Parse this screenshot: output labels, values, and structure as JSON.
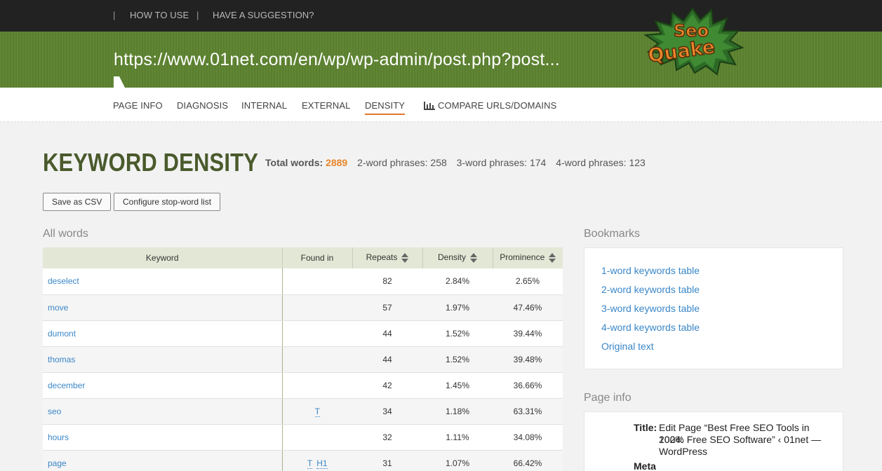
{
  "topbar": {
    "separators": [
      "|",
      "|"
    ],
    "links": [
      "HOW TO USE",
      "HAVE A SUGGESTION?"
    ]
  },
  "url": "https://www.01net.com/en/wp/wp-admin/post.php?post...",
  "logo": {
    "line1": "Seo",
    "line2": "Quake"
  },
  "nav": {
    "tabs": [
      "PAGE INFO",
      "DIAGNOSIS",
      "INTERNAL",
      "EXTERNAL",
      "DENSITY",
      "COMPARE URLS/DOMAINS"
    ],
    "active": "DENSITY",
    "compare_icon": "bar-chart-icon"
  },
  "heading": "KEYWORD DENSITY",
  "stats": {
    "total_label": "Total words:",
    "total_value": "2889",
    "two_label": "2-word phrases:",
    "two_value": "258",
    "three_label": "3-word phrases:",
    "three_value": "174",
    "four_label": "4-word phrases:",
    "four_value": "123"
  },
  "buttons": {
    "save_csv": "Save as CSV",
    "configure": "Configure stop-word list"
  },
  "all_words": {
    "title": "All words",
    "columns": [
      "Keyword",
      "Found in",
      "Repeats",
      "Density",
      "Prominence"
    ],
    "rows": [
      {
        "keyword": "deselect",
        "found_in": [],
        "repeats": "82",
        "density": "2.84%",
        "prominence": "2.65%"
      },
      {
        "keyword": "move",
        "found_in": [],
        "repeats": "57",
        "density": "1.97%",
        "prominence": "47.46%"
      },
      {
        "keyword": "dumont",
        "found_in": [],
        "repeats": "44",
        "density": "1.52%",
        "prominence": "39.44%"
      },
      {
        "keyword": "thomas",
        "found_in": [],
        "repeats": "44",
        "density": "1.52%",
        "prominence": "39.48%"
      },
      {
        "keyword": "december",
        "found_in": [],
        "repeats": "42",
        "density": "1.45%",
        "prominence": "36.66%"
      },
      {
        "keyword": "seo",
        "found_in": [
          "T"
        ],
        "repeats": "34",
        "density": "1.18%",
        "prominence": "63.31%"
      },
      {
        "keyword": "hours",
        "found_in": [],
        "repeats": "32",
        "density": "1.11%",
        "prominence": "34.08%"
      },
      {
        "keyword": "page",
        "found_in": [
          "T",
          "H1"
        ],
        "repeats": "31",
        "density": "1.07%",
        "prominence": "66.42%"
      }
    ]
  },
  "bookmarks": {
    "title": "Bookmarks",
    "items": [
      "1-word keywords table",
      "2-word keywords table",
      "3-word keywords table",
      "4-word keywords table",
      "Original text"
    ]
  },
  "page_info": {
    "title": "Page info",
    "title_label": "Title:",
    "title_lines": [
      "Edit Page “Best Free SEO Tools in 2024:",
      "100% Free SEO Software” ‹ 01net —",
      "WordPress"
    ],
    "meta_label": "Meta"
  },
  "colors": {
    "topbar": "#222222",
    "url_band": "#5c8230",
    "heading": "#4a5a2c",
    "accent_orange": "#e8862a",
    "link_blue": "#3a87c8",
    "table_header": "#e3e8d6"
  }
}
